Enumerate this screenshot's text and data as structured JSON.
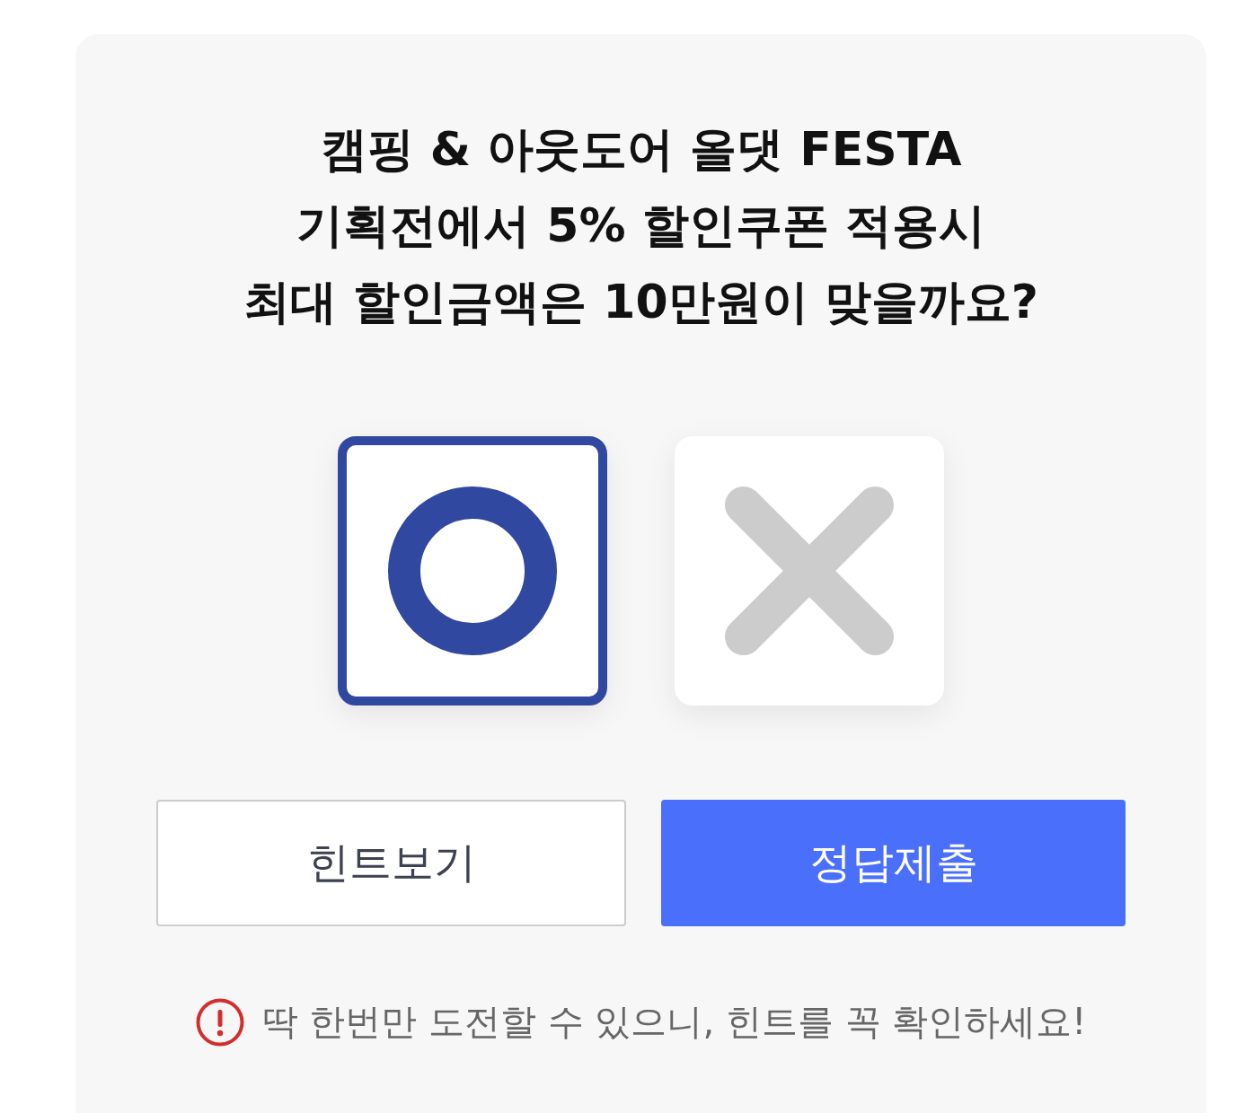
{
  "question": {
    "lines": [
      "캠핑 & 아웃도어 올댓 FESTA",
      "기획전에서 5% 할인쿠폰 적용시",
      "최대 할인금액은 10만원이 맞을까요?"
    ]
  },
  "choices": [
    {
      "kind": "o",
      "selected": true
    },
    {
      "kind": "x",
      "selected": false
    }
  ],
  "buttons": [
    {
      "label": "힌트보기",
      "kind": "secondary"
    },
    {
      "label": "정답제출",
      "kind": "primary"
    }
  ],
  "notice": {
    "text": "딱 한번만 도전할 수 있으니, 힌트를 꼭 확인하세요!"
  }
}
